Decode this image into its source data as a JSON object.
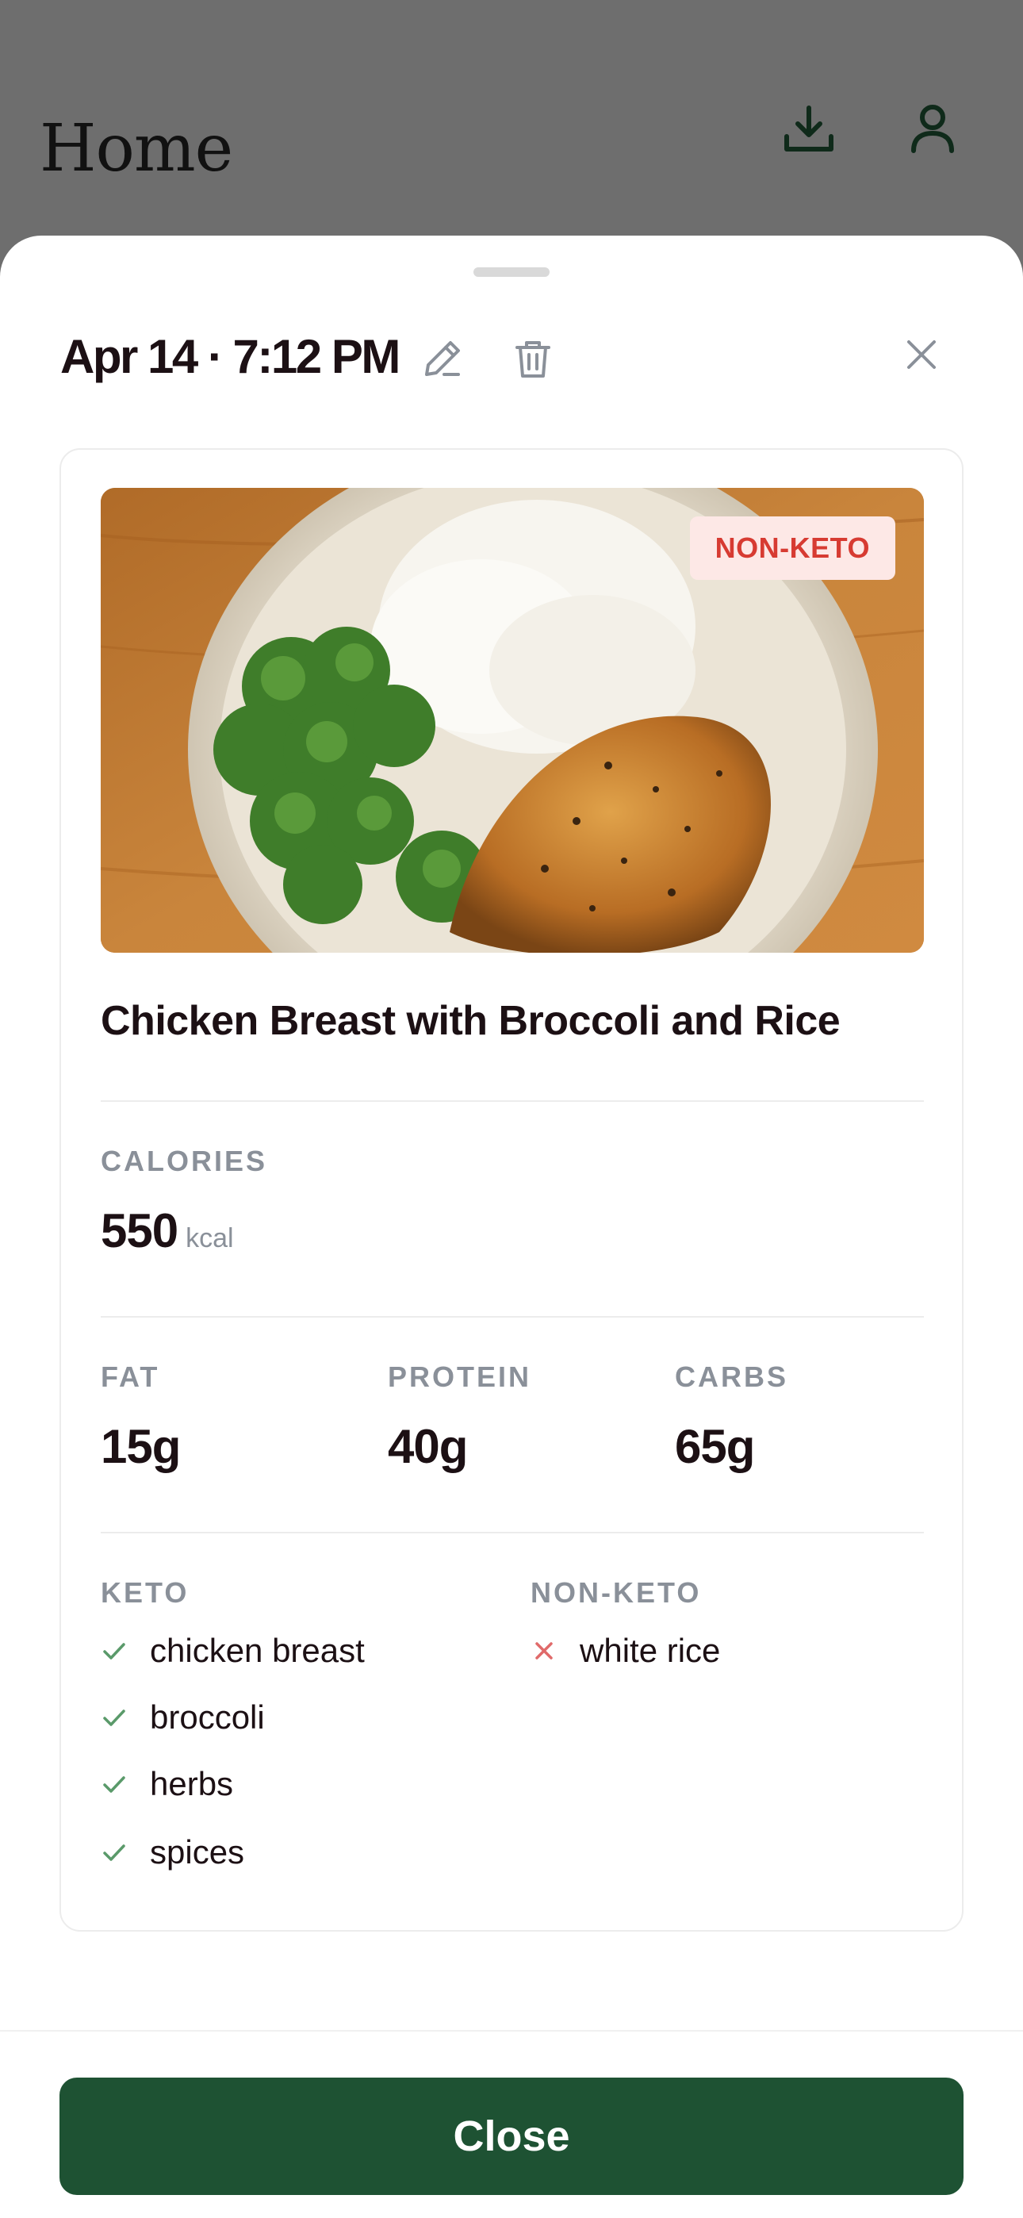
{
  "background": {
    "title": "Home",
    "icons": [
      "download-icon",
      "profile-icon"
    ]
  },
  "sheet": {
    "date": "Apr 14 · 7:12 PM",
    "icons": [
      "edit-icon",
      "trash-icon",
      "close-icon"
    ]
  },
  "meal": {
    "badge": "NON-KETO",
    "title": "Chicken Breast with Broccoli and Rice",
    "calories_label": "CALORIES",
    "calories_value": "550",
    "calories_unit": "kcal",
    "macros": [
      {
        "label": "FAT",
        "value": "15g"
      },
      {
        "label": "PROTEIN",
        "value": "40g"
      },
      {
        "label": "CARBS",
        "value": "65g"
      }
    ],
    "keto_label": "KETO",
    "keto_items": [
      "chicken breast",
      "broccoli",
      "herbs",
      "spices"
    ],
    "nonketo_label": "NON-KETO",
    "nonketo_items": [
      "white rice"
    ]
  },
  "footer": {
    "close_label": "Close"
  },
  "colors": {
    "primary": "#1e5233",
    "badge_bg": "#fde8e6",
    "badge_text": "#d73b32",
    "check": "#5a9a6a",
    "cross": "#e06a6a"
  }
}
